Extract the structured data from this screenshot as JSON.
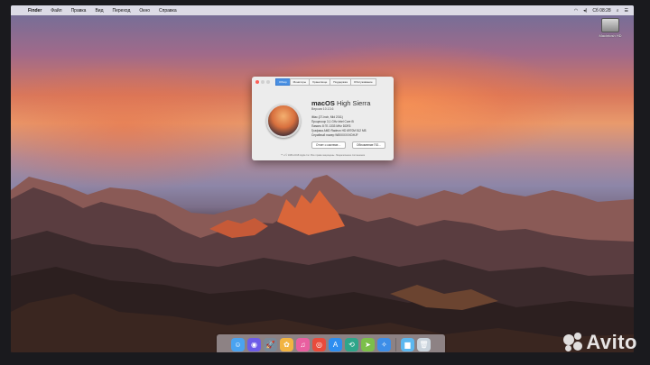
{
  "menubar": {
    "apple_icon": "apple-logo",
    "items": [
      "Finder",
      "Файл",
      "Правка",
      "Вид",
      "Переход",
      "Окно",
      "Справка"
    ],
    "clock": "Сб 08:28"
  },
  "desktop": {
    "disk_label": "Macintosh HD"
  },
  "about_window": {
    "tabs": [
      "Обзор",
      "Мониторы",
      "Хранилище",
      "Поддержка",
      "Обслуживание"
    ],
    "active_tab": "Обзор",
    "os_name_bold": "macOS",
    "os_name_light": "High Sierra",
    "version": "Версия 10.13.6",
    "specs": [
      "iMac (27-inch, Mid 2011)",
      "Процессор  3,1 GHz Intel Core i5",
      "Память  8 ГБ 1333 MHz DDR3",
      "Графика  AMD Radeon HD 6970M 512 МБ",
      "Серийный номер  W80XXXXXDHJF"
    ],
    "buttons": [
      "Отчет о системе…",
      "Обновление ПО…"
    ],
    "footer": "™ и © 1983-2018 Apple Inc. Все права защищены. Лицензионное соглашение"
  },
  "dock": {
    "apps": [
      {
        "name": "finder",
        "color": "#4aa3f0",
        "glyph": "☺"
      },
      {
        "name": "siri",
        "color": "#6d5ce8",
        "glyph": "◉"
      },
      {
        "name": "launchpad",
        "color": "#7b8a99",
        "glyph": "🚀"
      },
      {
        "name": "photos",
        "color": "#f2b441",
        "glyph": "✿"
      },
      {
        "name": "itunes",
        "color": "#e95fa0",
        "glyph": "♫"
      },
      {
        "name": "chrome",
        "color": "#e94b3c",
        "glyph": "◎"
      },
      {
        "name": "app-store",
        "color": "#2d8ef0",
        "glyph": "A"
      },
      {
        "name": "time-machine",
        "color": "#2fa58a",
        "glyph": "⟲"
      },
      {
        "name": "maps",
        "color": "#7cbf4a",
        "glyph": "➤"
      },
      {
        "name": "safari",
        "color": "#3d8ee8",
        "glyph": "✧"
      }
    ],
    "folder": {
      "name": "downloads-folder",
      "color": "#5cb8f0",
      "glyph": "▆"
    },
    "trash": {
      "name": "trash",
      "color": "#c9d3dc",
      "glyph": "🗑"
    }
  },
  "watermark": "Avito"
}
